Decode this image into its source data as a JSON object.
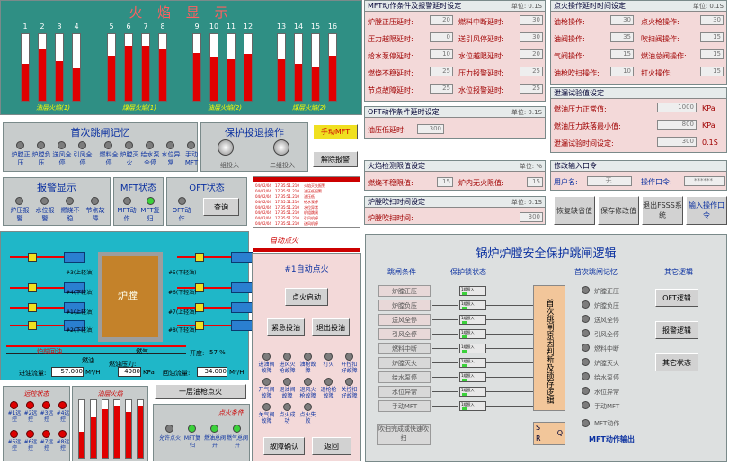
{
  "flame": {
    "title": "火 焰 显 示",
    "bars": [
      {
        "n": "1",
        "v": 0.55
      },
      {
        "n": "2",
        "v": 0.78
      },
      {
        "n": "3",
        "v": 0.6
      },
      {
        "n": "4",
        "v": 0.48
      },
      {
        "n": "5",
        "v": 0.68
      },
      {
        "n": "6",
        "v": 0.82
      },
      {
        "n": "7",
        "v": 0.82
      },
      {
        "n": "8",
        "v": 0.78
      },
      {
        "n": "9",
        "v": 0.72
      },
      {
        "n": "10",
        "v": 0.66
      },
      {
        "n": "11",
        "v": 0.62
      },
      {
        "n": "12",
        "v": 0.7
      },
      {
        "n": "13",
        "v": 0.62
      },
      {
        "n": "14",
        "v": 0.56
      },
      {
        "n": "15",
        "v": 0.5
      },
      {
        "n": "16",
        "v": 0.68
      }
    ],
    "groups": [
      "油层火焰(1)",
      "煤层火焰(1)",
      "油层火焰(2)",
      "煤层火焰(2)"
    ]
  },
  "first_trip": {
    "title": "首次跳闸记忆",
    "lamps": [
      "炉膛正压",
      "炉膛负压",
      "送风全停",
      "引风全停",
      "燃料全停",
      "炉膛灭火",
      "给水泵全停",
      "水位异常",
      "手动MFT"
    ]
  },
  "protect": {
    "title": "保护投退操作",
    "switch1": "一组投入",
    "switch2": "二组投入",
    "manual_mft": "手动MFT",
    "reset_alarm": "解除报警"
  },
  "alarm": {
    "title": "报警显示",
    "lamps": [
      "炉压报警",
      "水位报警",
      "燃烧不稳",
      "节点故障"
    ]
  },
  "mft_state": {
    "title": "MFT状态",
    "lamps": [
      "MFT动作",
      "MFT复归"
    ]
  },
  "oft_state": {
    "title": "OFT状态",
    "lamp": "OFT动作",
    "query": "查询"
  },
  "events": [
    [
      "04/02/04",
      "17:35:51.210",
      "火焰灭失报警"
    ],
    [
      "04/02/04",
      "17:35:51.210",
      "油压低报警"
    ],
    [
      "04/02/04",
      "17:35:51.210",
      "油压低"
    ],
    [
      "04/02/04",
      "17:35:51.210",
      "给水泵停"
    ],
    [
      "04/02/04",
      "17:35:51.210",
      "水位异常"
    ],
    [
      "04/02/04",
      "17:35:51.210",
      "机组跳闸"
    ],
    [
      "04/02/04",
      "17:35:51.210",
      "引风机停"
    ],
    [
      "04/02/04",
      "17:35:51.210",
      "送风机停"
    ]
  ],
  "mft_delay": {
    "title": "MFT动作条件及报警延时设定",
    "unit": "单位: 0.1S",
    "rows": [
      [
        "炉膛正压延时:",
        "20",
        "燃料中断延时:",
        "30"
      ],
      [
        "压力越限延时:",
        "0",
        "送引风停延时:",
        "30"
      ],
      [
        "给水泵停延时:",
        "10",
        "水位越限延时:",
        "20"
      ],
      [
        "燃烧不稳延时:",
        "25",
        "压力报警延时:",
        "25"
      ],
      [
        "节点故障延时:",
        "25",
        "水位报警延时:",
        "25"
      ]
    ]
  },
  "oft_delay": {
    "title": "OFT动作条件延时设定",
    "unit": "单位: 0.1S",
    "label": "油压低延时:",
    "value": "300"
  },
  "flame_limit": {
    "title": "火焰检测限值设定",
    "unit": "单位: %",
    "label1": "燃烧不稳限值:",
    "value1": "15",
    "label2": "炉内无火限值:",
    "value2": "15"
  },
  "purge_time": {
    "title": "炉膛吹扫时间设定",
    "unit": "单位: 0.1S",
    "label": "炉膛吹扫时间:",
    "value": "300"
  },
  "ignite_delay": {
    "title": "点火操作延时时间设定",
    "unit": "单位: 0.1S",
    "rows": [
      [
        "油枪操作:",
        "30",
        "点火枪操作:",
        "30"
      ],
      [
        "油阀操作:",
        "35",
        "吹扫阀操作:",
        "15"
      ],
      [
        "气阀操作:",
        "15",
        "燃油总阀操作:",
        "15"
      ],
      [
        "油枪吹扫操作:",
        "10",
        "打火操作:",
        "15"
      ]
    ]
  },
  "leak_test": {
    "title": "泄漏试验值设定",
    "rows": [
      [
        "燃油压力正常值:",
        "1000",
        "KPa"
      ],
      [
        "燃油压力跌落最小值:",
        "800",
        "KPa"
      ],
      [
        "泄漏试验时间设定:",
        "300",
        "0.1S"
      ]
    ]
  },
  "pwd": {
    "title": "修改输入口令",
    "user_label": "用户名:",
    "user": "无",
    "pwd_label": "操作口令:",
    "pwd": "******"
  },
  "cmd": {
    "restore": "恢复缺省值",
    "save": "保存修改值",
    "exit": "退出FSSS系统",
    "input": "输入操作口令"
  },
  "furnace": {
    "label": "炉膛",
    "burners": [
      "#3(上轻油)",
      "#4(下轻油)",
      "#1(上轻油)",
      "#2(下轻油)",
      "#5(下轻油)",
      "#6(下轻油)",
      "#7(上轻油)",
      "#8(下轻油)"
    ],
    "recirc": "炉前回油",
    "fuel": "燃油",
    "gas": "燃气",
    "pressure_label": "燃油压力:",
    "pressure": "4980",
    "pressure_unit": "KPa",
    "open_label": "开度:",
    "open": "57 %",
    "inflow_label": "进油流量:",
    "inflow": "57.000",
    "inflow_unit": "M³/H",
    "outflow_label": "回油流量:",
    "outflow": "34.000",
    "outflow_unit": "M³/H",
    "auto_label": "自动点火"
  },
  "autoign": {
    "title": "#1自动点火",
    "start": "点火启动",
    "stop_fire": "紧急投油",
    "exit_oil": "退出投油",
    "lamps": [
      "进油阀故障",
      "进风火枪故障",
      "油枪故障",
      "打火",
      "开控扣好故障",
      "开气阀故障",
      "退油阀故障",
      "退风火枪故障",
      "退枪枪故障",
      "关控扣好故障",
      "关气阀故障",
      "点火成功",
      "点火失败"
    ],
    "fault": "故障确认",
    "back": "返回"
  },
  "oneburner": "一层油枪点火",
  "remote": {
    "title": "远控状态",
    "labels": [
      "#1远控",
      "#2远控",
      "#3远控",
      "#4远控",
      "#5远控",
      "#6远控",
      "#7远控",
      "#8远控"
    ]
  },
  "oilflame": {
    "title": "油层火焰",
    "vals": [
      0.45,
      0.7,
      0.85,
      0.9,
      0.8,
      0.9
    ]
  },
  "ign_cond": {
    "title": "点火条件",
    "items": [
      "允许点火",
      "MFT复归",
      "燃油总阀开",
      "燃气总阀开"
    ]
  },
  "logic": {
    "title": "锅炉炉膛安全保护跳闸逻辑",
    "col_cond": "跳闸条件",
    "col_lock": "保护锁状态",
    "col_mem": "首次跳闸记忆",
    "col_extra": "其它逻辑",
    "conds": [
      "炉膛正压",
      "炉膛负压",
      "送风全停",
      "引风全停",
      "燃料中断",
      "炉膛灭火",
      "给水泵停",
      "水位异常",
      "手动MFT"
    ],
    "mems": [
      "炉膛正压",
      "炉膛负压",
      "送风全停",
      "引风全停",
      "燃料中断",
      "炉膛灭火",
      "给水泵停",
      "水位异常",
      "手动MFT"
    ],
    "center": "首次跳闸原因判断及锁存逻辑",
    "extra": [
      "OFT逻辑",
      "报警逻辑",
      "其它状态"
    ],
    "purge": "吹扫完成或快速吹扫",
    "mft_act": "MFT动作",
    "mft_out": "MFT动作输出",
    "lock_lbl": "1组投入",
    "sr_s": "S",
    "sr_r": "R",
    "sr_q": "Q"
  }
}
